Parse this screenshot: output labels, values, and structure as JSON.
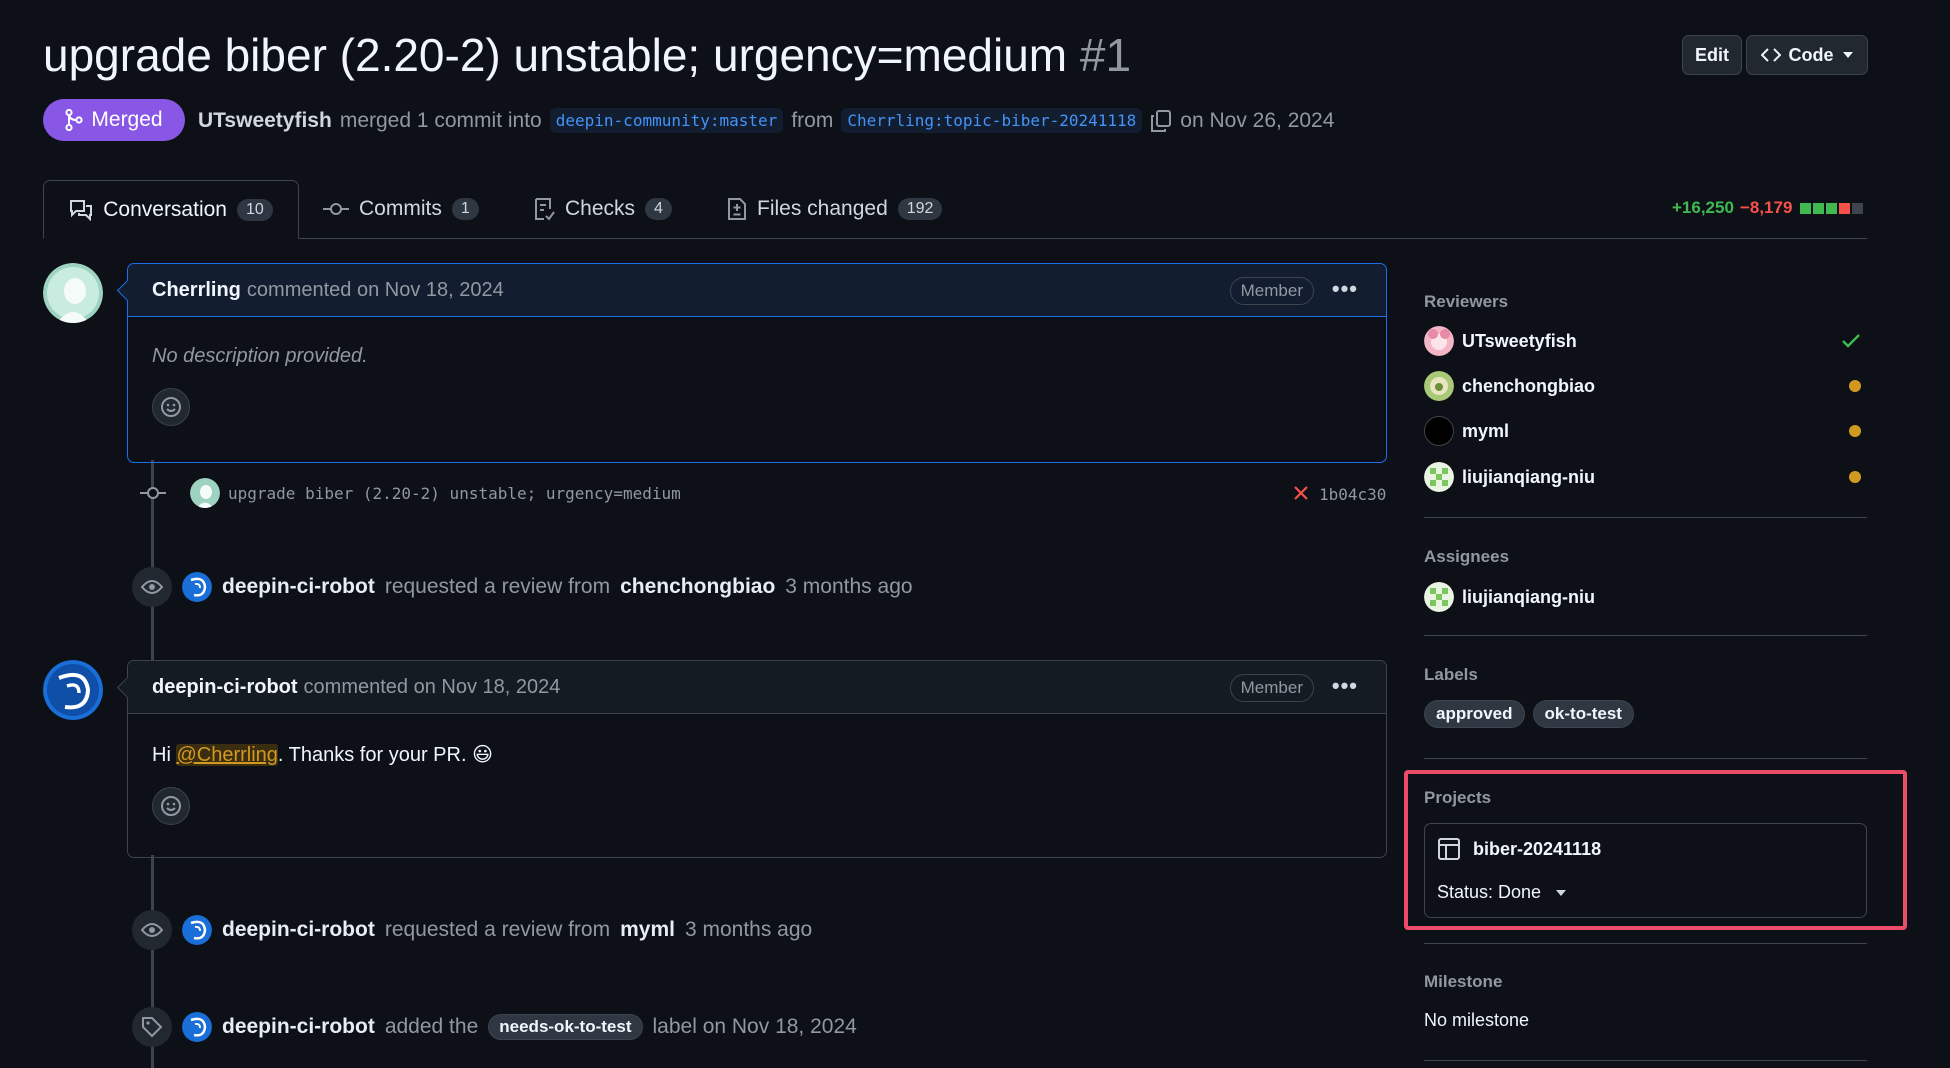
{
  "header": {
    "title": "upgrade biber (2.20-2) unstable; urgency=medium",
    "number": "#1",
    "edit_label": "Edit",
    "code_label": "Code",
    "state": "Merged",
    "author": "UTsweetyfish",
    "merge_text": "merged 1 commit into",
    "base_branch": "deepin-community:master",
    "from_text": "from",
    "head_branch": "Cherrling:topic-biber-20241118",
    "date_text": "on Nov 26, 2024"
  },
  "tabs": [
    {
      "label": "Conversation",
      "count": "10"
    },
    {
      "label": "Commits",
      "count": "1"
    },
    {
      "label": "Checks",
      "count": "4"
    },
    {
      "label": "Files changed",
      "count": "192"
    }
  ],
  "diffstat": {
    "additions": "+16,250",
    "deletions": "−8,179"
  },
  "timeline": {
    "comment1": {
      "author": "Cherrling",
      "meta": "commented on Nov 18, 2024",
      "role": "Member",
      "body": "No description provided."
    },
    "commit": {
      "message": "upgrade biber (2.20-2) unstable; urgency=medium",
      "sha": "1b04c30"
    },
    "event1": {
      "actor": "deepin-ci-robot",
      "action": "requested a review from",
      "target": "chenchongbiao",
      "time": "3 months ago"
    },
    "comment2": {
      "author": "deepin-ci-robot",
      "meta": "commented on Nov 18, 2024",
      "role": "Member",
      "greeting": "Hi",
      "mention": "@Cherrling",
      "rest": ". Thanks for your PR.",
      "emoji": "😃"
    },
    "event2": {
      "actor": "deepin-ci-robot",
      "action": "requested a review from",
      "target": "myml",
      "time": "3 months ago"
    },
    "event3": {
      "actor": "deepin-ci-robot",
      "action": "added the",
      "label": "needs-ok-to-test",
      "after": "label on Nov 18, 2024"
    }
  },
  "sidebar": {
    "reviewers_title": "Reviewers",
    "reviewers": [
      {
        "name": "UTsweetyfish",
        "status": "approved"
      },
      {
        "name": "chenchongbiao",
        "status": "pending"
      },
      {
        "name": "myml",
        "status": "pending"
      },
      {
        "name": "liujianqiang-niu",
        "status": "pending"
      }
    ],
    "assignees_title": "Assignees",
    "assignee": "liujianqiang-niu",
    "labels_title": "Labels",
    "labels": [
      "approved",
      "ok-to-test"
    ],
    "projects_title": "Projects",
    "project_name": "biber-20241118",
    "project_status": "Status: Done",
    "milestone_title": "Milestone",
    "milestone_value": "No milestone"
  },
  "colors": {
    "merged": "#8957e5",
    "highlight": "#ec4c68",
    "pending": "#d29922",
    "approved": "#3fb950"
  }
}
